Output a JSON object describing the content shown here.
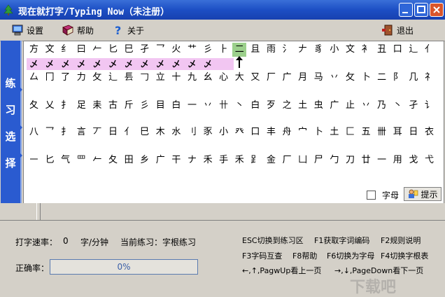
{
  "window": {
    "title": "现在就打字/Typing Now（未注册）"
  },
  "menu": {
    "settings": "设置",
    "help": "帮助",
    "about": "关于",
    "exit": "退出"
  },
  "sidebar": {
    "chars": [
      "练",
      "习",
      "选",
      "择"
    ]
  },
  "grid": {
    "rows": [
      [
        "方",
        "文",
        "纟",
        "曰",
        "𠂉",
        "匕",
        "巳",
        "孑",
        "乛",
        "火",
        "艹",
        "彡",
        "⺊",
        "二",
        "且",
        "雨",
        "氵",
        "𠂇",
        "豸",
        "小",
        "文",
        "衤",
        "丑",
        "口",
        "辶",
        "亻"
      ],
      [
        "",
        "",
        "",
        "",
        "",
        "",
        "",
        "",
        "",
        "",
        "",
        "",
        "",
        "",
        "",
        "",
        "",
        "",
        "",
        "",
        "",
        "",
        "",
        "",
        "",
        "",
        ""
      ],
      [
        "厶",
        "冂",
        "了",
        "力",
        "攵",
        "辶",
        "镸",
        "𠃌",
        "立",
        "十",
        "九",
        "幺",
        "心",
        "大",
        "又",
        "厂",
        "广",
        "月",
        "马",
        "丷",
        "攵",
        "卜",
        "二",
        "阝",
        "几",
        "礻"
      ],
      [
        "夂",
        "乂",
        "扌",
        "足",
        "耒",
        "古",
        "斤",
        "彡",
        "目",
        "白",
        "一",
        "丷",
        "卄",
        "丶",
        "白",
        "歹",
        "之",
        "土",
        "虫",
        "广",
        "止",
        "丷",
        "乃",
        "丶",
        "孑",
        "讠"
      ],
      [
        "八",
        "乛",
        "扌",
        "言",
        "丆",
        "日",
        "亻",
        "巳",
        "木",
        "水",
        "刂",
        "豕",
        "小",
        "癶",
        "口",
        "丰",
        "舟",
        "宀",
        "卜",
        "土",
        "匚",
        "五",
        "卌",
        "耳",
        "日",
        "衣"
      ],
      [
        "㇐",
        "匕",
        "气",
        "罒",
        "𠂉",
        "夂",
        "田",
        "乡",
        "广",
        "干",
        "ナ",
        "禾",
        "手",
        "禾",
        "𧾷",
        "金",
        "厂",
        "凵",
        "尸",
        "勹",
        "刀",
        "廿",
        "一",
        "用",
        "戈",
        "弋"
      ]
    ],
    "typed": [
      "乄",
      "乄",
      "乄",
      "乄",
      "乄",
      "乄",
      "乄",
      "乄",
      "乄",
      "乄",
      "乄",
      "乄"
    ],
    "current_index": 12
  },
  "options": {
    "letters_label": "字母",
    "hint_label": "提示"
  },
  "stats": {
    "speed_label": "打字速率：",
    "speed_value": "0",
    "speed_unit": "字/分钟",
    "current_label": "当前练习：",
    "current_value": "字根练习",
    "accuracy_label": "正确率：",
    "accuracy_value": "0%",
    "accuracy_fraction": 0
  },
  "help_lines": {
    "line1a": "ESC切换到练习区",
    "line1b": "F1获取字词编码",
    "line1c": "F2规则说明",
    "line2a": "F3字码互查",
    "line2b": "F8帮助",
    "line2c": "F6切换为字母",
    "line2d": "F4切换字根表",
    "line3a": "←,↑,PagwUp看上一页",
    "line3b": "→,↓,PageDown看下一页"
  },
  "watermark": "下载吧",
  "colors": {
    "title_bar": "#1d4fc4",
    "sidebar": "#2a5bd0",
    "typed_highlight": "#f2c6f2",
    "current_highlight": "#9cd08c"
  }
}
